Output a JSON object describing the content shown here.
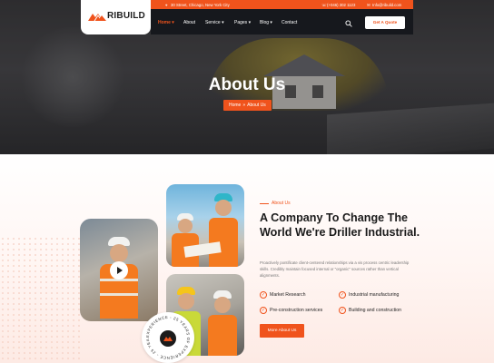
{
  "brand": {
    "name": "RIBUILD",
    "accent": "#f0531c"
  },
  "topbar": {
    "address": "30 Street, Chicago, New York City",
    "phone": "(+046) 302 1123",
    "email": "Info@ribuild.com"
  },
  "nav": {
    "items": [
      "Home",
      "About",
      "Service",
      "Pages",
      "Blog",
      "Contact"
    ],
    "active": "Home",
    "quote_label": "Get A Quote"
  },
  "hero": {
    "title": "About Us",
    "breadcrumb": {
      "home": "Home",
      "separator": "»",
      "current": "About Us"
    }
  },
  "about": {
    "subtitle": "About Us",
    "heading": "A Company To Change The World We're Driller Industrial.",
    "paragraph": "Proactively pontificate client-centered relationships via a vis process centric leadership skills. Credibly maintain focused internal or \"organic\" sources rather than vertical alignments.",
    "features": [
      "Market Research",
      "Industrial manufacturing",
      "Pre-construction services",
      "Building and construction"
    ],
    "button_label": "More About Us",
    "badge_text": "EXPERIENCE - 25 YEARS OF EXPERIENCE - 25 YEARS OF"
  },
  "icons": [
    "logo-icon",
    "location-icon",
    "phone-icon",
    "mail-icon",
    "search-icon",
    "play-icon",
    "check-icon"
  ]
}
